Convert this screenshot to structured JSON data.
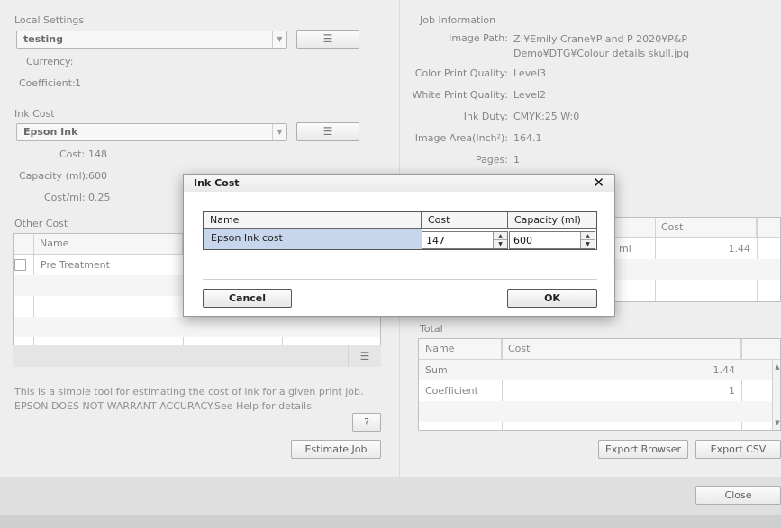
{
  "local_settings": {
    "title": "Local Settings",
    "profile_value": "testing",
    "currency_label": "Currency:",
    "currency_value": "",
    "coefficient_label": "Coefficient:",
    "coefficient_value": "1"
  },
  "ink_cost": {
    "title": "Ink Cost",
    "ink_value": "Epson Ink",
    "cost_label": "Cost:",
    "cost_value": "148",
    "capacity_label": "Capacity (ml):",
    "capacity_value": "600",
    "cost_per_ml_label": "Cost/ml:",
    "cost_per_ml_value": "0.25"
  },
  "other_cost": {
    "title": "Other Cost",
    "col_name": "Name",
    "rows": [
      {
        "name": "Pre Treatment"
      }
    ]
  },
  "disclaimer": "This is a simple tool for estimating the cost of ink for a given print job. EPSON DOES NOT WARRANT ACCURACY.See Help for details.",
  "help_label": "?",
  "estimate_label": "Estimate Job",
  "job_info": {
    "title": "Job Information",
    "fields": [
      {
        "label": "Image Path:",
        "value": "Z:¥Emily Crane¥P and P 2020¥P&P Demo¥DTG¥Colour details skull.jpg"
      },
      {
        "label": "Color Print Quality:",
        "value": "Level3"
      },
      {
        "label": "White Print Quality:",
        "value": "Level2"
      },
      {
        "label": "Ink Duty:",
        "value": "CMYK:25 W:0"
      },
      {
        "label": "Image Area(Inch²):",
        "value": "164.1"
      },
      {
        "label": "Pages:",
        "value": "1"
      }
    ]
  },
  "detail_table": {
    "col_cost": "Cost",
    "row_name_fragment": "ml",
    "row_cost": "1.44"
  },
  "total": {
    "title": "Total",
    "col_name": "Name",
    "col_cost": "Cost",
    "rows": [
      {
        "name": "Sum",
        "cost": "1.44"
      },
      {
        "name": "Coefficient",
        "cost": "1"
      }
    ]
  },
  "export_browser_label": "Export Browser",
  "export_csv_label": "Export CSV",
  "close_label": "Close",
  "dialog": {
    "title": "Ink Cost",
    "close_glyph": "✕",
    "col_name": "Name",
    "col_cost": "Cost",
    "col_capacity": "Capacity (ml)",
    "row_name": "Epson Ink cost",
    "row_cost": "147",
    "row_capacity": "600",
    "cancel_label": "Cancel",
    "ok_label": "OK"
  }
}
